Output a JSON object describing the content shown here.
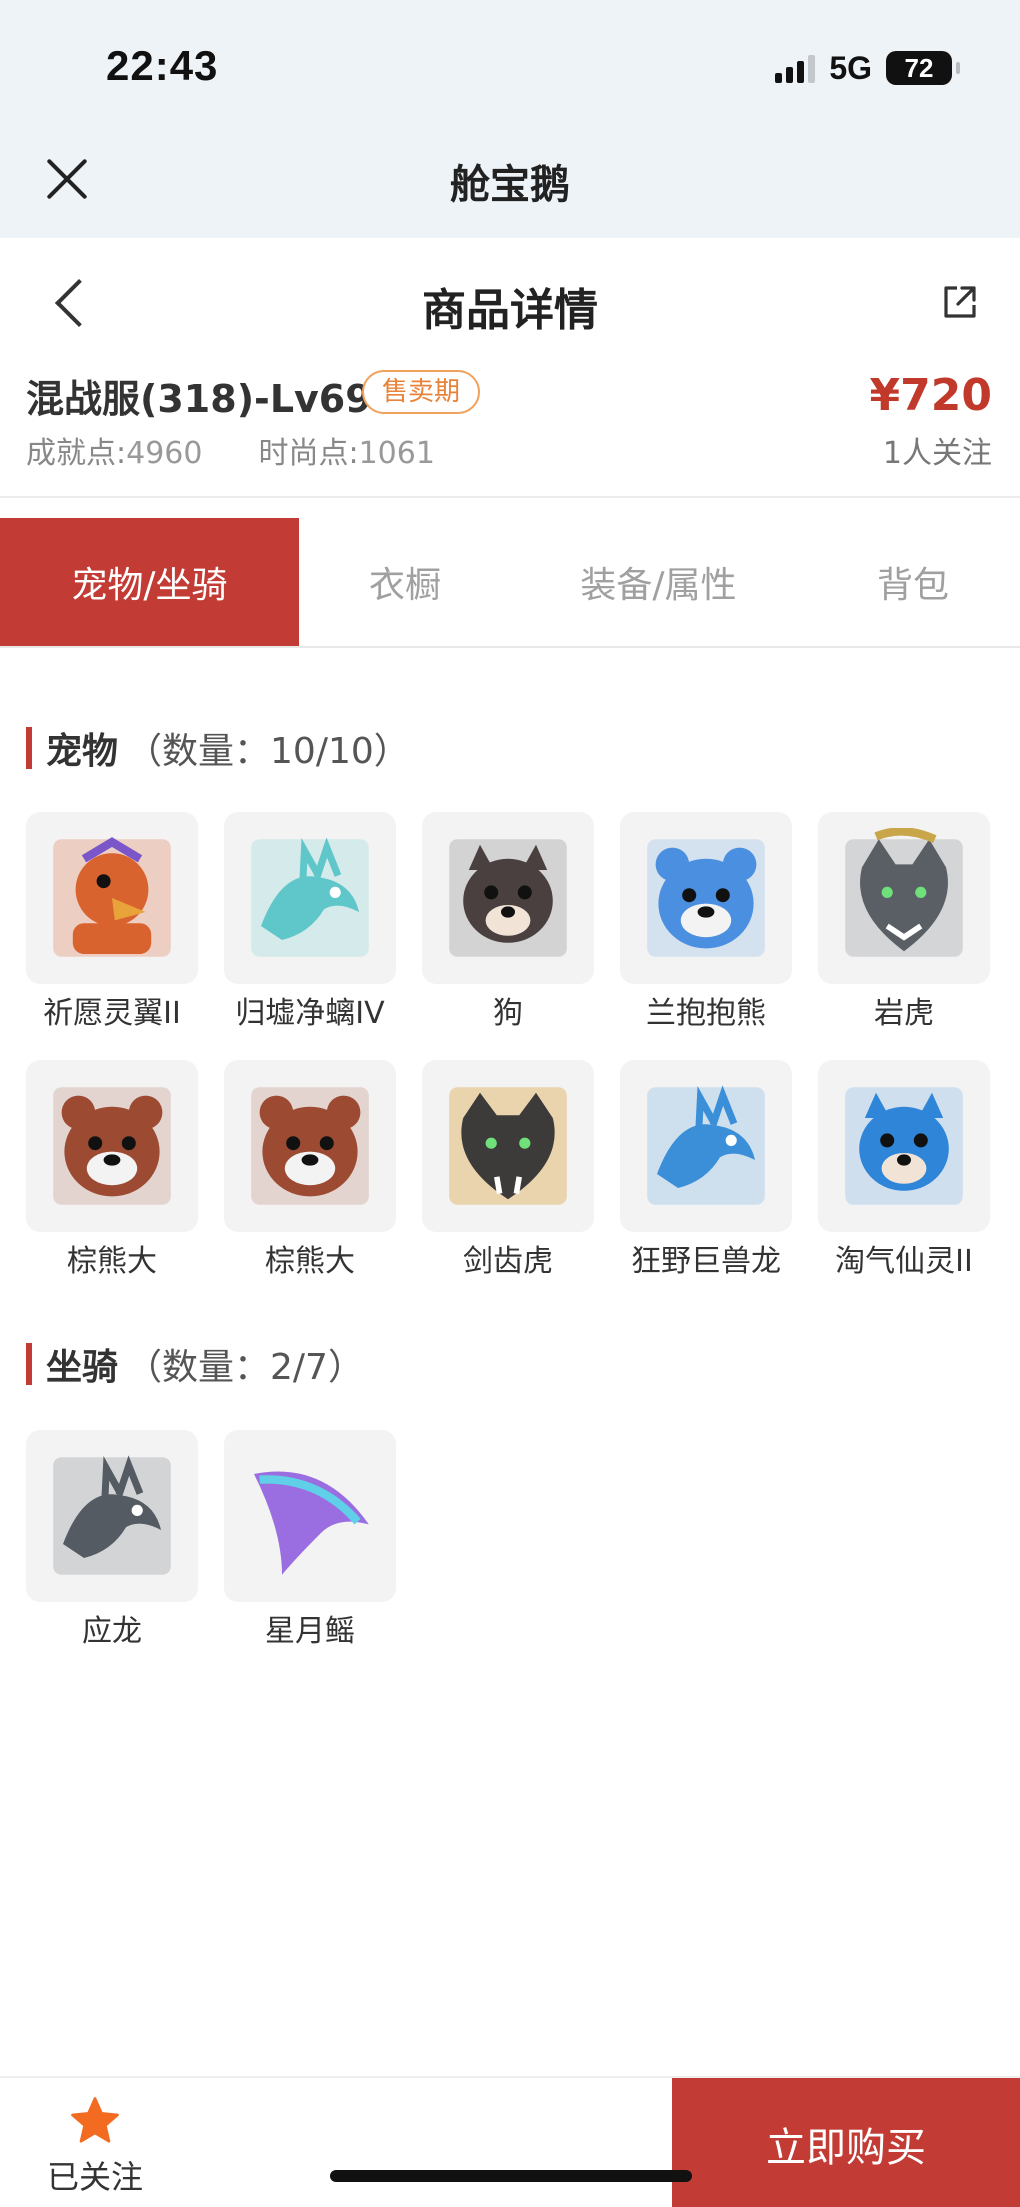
{
  "status_bar": {
    "time": "22:43",
    "network": "5G",
    "battery": "72"
  },
  "app": {
    "title": "舱宝鹅"
  },
  "nav": {
    "title": "商品详情"
  },
  "product": {
    "name": "混战服(318)-Lv69",
    "badge": "售卖期",
    "achievement_label": "成就点:",
    "achievement_value": "4960",
    "fashion_label": "时尚点:",
    "fashion_value": "1061",
    "price": "¥720",
    "followers": "1人关注"
  },
  "tabs": [
    {
      "label": "宠物/坐骑",
      "active": true
    },
    {
      "label": "衣橱",
      "active": false
    },
    {
      "label": "装备/属性",
      "active": false
    },
    {
      "label": "背包",
      "active": false
    }
  ],
  "pets": {
    "title": "宠物",
    "count": "（数量：10/10）",
    "items": [
      {
        "name": "祈愿灵翼II",
        "icon": "bird-icon",
        "color": "#d9632e"
      },
      {
        "name": "归墟净螭IV",
        "icon": "dragon-icon",
        "color": "#5fc6c9"
      },
      {
        "name": "狗",
        "icon": "dog-icon",
        "color": "#4a4040"
      },
      {
        "name": "兰抱抱熊",
        "icon": "bear-icon",
        "color": "#4a8fe0"
      },
      {
        "name": "岩虎",
        "icon": "wolf-icon",
        "color": "#5a5f66"
      },
      {
        "name": "棕熊大",
        "icon": "bear-icon",
        "color": "#9c4a32"
      },
      {
        "name": "棕熊大",
        "icon": "bear-icon",
        "color": "#9c4a32"
      },
      {
        "name": "剑齿虎",
        "icon": "tiger-icon",
        "color": "#3d3a3a"
      },
      {
        "name": "狂野巨兽龙",
        "icon": "dragon-icon",
        "color": "#3a8fd8"
      },
      {
        "name": "淘气仙灵II",
        "icon": "dog-icon",
        "color": "#2f86d8"
      }
    ]
  },
  "mounts": {
    "title": "坐骑",
    "count": "（数量：2/7）",
    "items": [
      {
        "name": "应龙",
        "icon": "dragon-icon",
        "color": "#555b63"
      },
      {
        "name": "星月鳐",
        "icon": "ray-icon",
        "color": "#9a6ee0"
      }
    ]
  },
  "bottom": {
    "follow_label": "已关注",
    "buy_label": "立即购买"
  },
  "colors": {
    "accent": "#c23b35",
    "price": "#c0392b",
    "badge": "#e8833a",
    "header_bg": "#edf3f7"
  }
}
